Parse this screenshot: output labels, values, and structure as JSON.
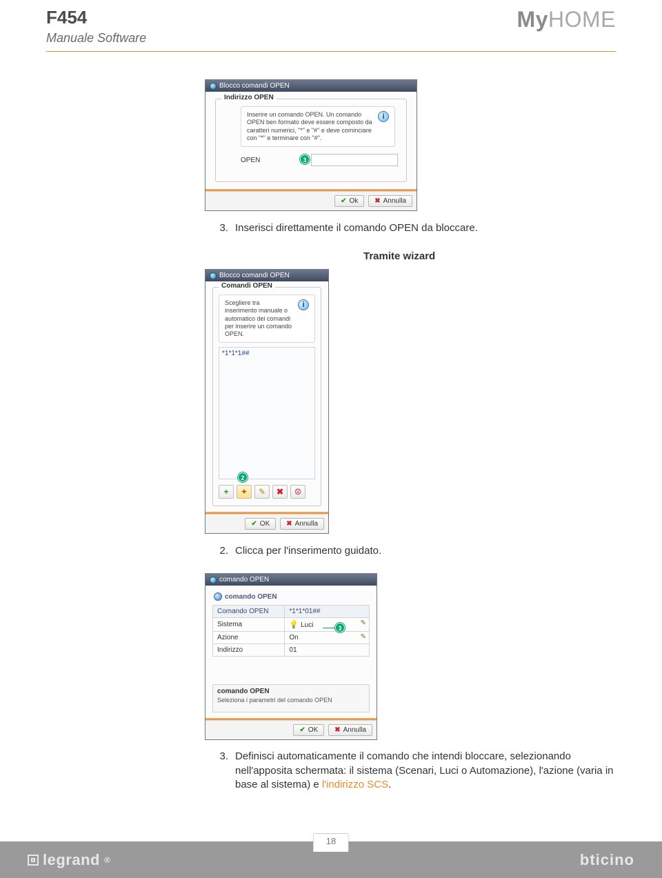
{
  "header": {
    "product": "F454",
    "subtitle": "Manuale Software",
    "brand_prefix": "My",
    "brand_suffix": "HOME"
  },
  "dialog1": {
    "title": "Blocco comandi OPEN",
    "legend": "Indirizzo OPEN",
    "info": "Inserire un comando OPEN. Un comando OPEN ben formato deve essere composto da caratteri numerici, \"*\" e \"#\" e deve cominciare con \"*\" e terminare con \"#\".",
    "open_label": "OPEN",
    "callout": "3",
    "ok": "Ok",
    "cancel": "Annulla"
  },
  "step3a": {
    "num": "3.",
    "text": "Inserisci direttamente il comando OPEN da bloccare."
  },
  "section2_heading": "Tramite wizard",
  "dialog2": {
    "title": "Blocco comandi OPEN",
    "legend": "Comandi OPEN",
    "info": "Scegliere tra inserimento manuale o automatico dei comandi per inserire un comando OPEN.",
    "list_entry": "*1*1*1##",
    "callout": "2",
    "ok": "OK",
    "cancel": "Annulla"
  },
  "step2": {
    "num": "2.",
    "text": "Clicca per l'inserimento guidato."
  },
  "dialog3": {
    "title": "comando OPEN",
    "heading": "comando OPEN",
    "rows": {
      "r1": {
        "k": "Comando OPEN",
        "v": "*1*1*01##"
      },
      "r2": {
        "k": "Sistema",
        "v": "Luci"
      },
      "r3": {
        "k": "Azione",
        "v": "On"
      },
      "r4": {
        "k": "Indirizzo",
        "v": "01"
      }
    },
    "callout": "3",
    "hint_title": "comando OPEN",
    "hint_text": "Seleziona i parametri del comando OPEN",
    "ok": "OK",
    "cancel": "Annulla"
  },
  "step3b": {
    "num": "3.",
    "text_a": "Definisci automaticamente il comando che intendi bloccare, selezionando nell'apposita schermata: il sistema (Scenari, Luci o Automazione), l'azione (varia in base al sistema) e ",
    "link": "l'indirizzo SCS",
    "text_b": "."
  },
  "footer": {
    "legrand": "legrand",
    "page": "18",
    "bticino": "bticino"
  }
}
